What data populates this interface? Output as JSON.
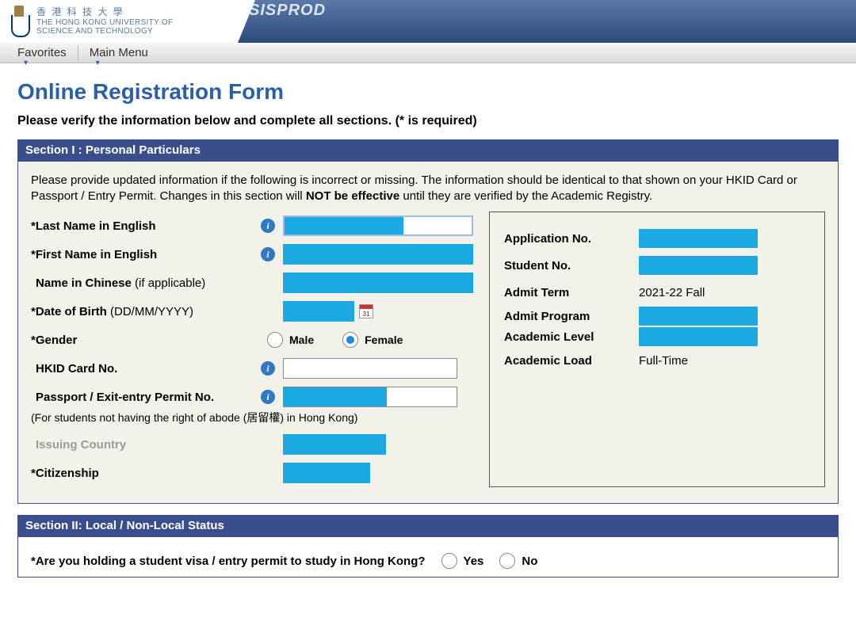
{
  "header": {
    "uni_zh": "香 港 科 技 大 學",
    "uni_en1": "THE HONG KONG UNIVERSITY OF",
    "uni_en2": "SCIENCE AND TECHNOLOGY",
    "sisprod": "SISPROD"
  },
  "menu": {
    "favorites": "Favorites",
    "main_menu": "Main Menu"
  },
  "page": {
    "title": "Online Registration Form",
    "instruction": "Please verify the information below and complete all sections. (* is required)"
  },
  "section1": {
    "header": "Section I : Personal Particulars",
    "desc_a": "Please provide updated information if the following is incorrect or missing. The information should be identical to that shown on your HKID Card or Passport / Entry Permit. Changes in this section will ",
    "desc_b": "NOT be effective",
    "desc_c": " until they are verified by the Academic Registry.",
    "labels": {
      "last_name": "*Last Name in English",
      "first_name": "*First Name in English",
      "name_chinese_a": "Name in Chinese ",
      "name_chinese_b": "(if applicable)",
      "dob_a": "*Date of Birth ",
      "dob_b": "(DD/MM/YYYY)",
      "gender": "*Gender",
      "male": "Male",
      "female": "Female",
      "hkid": "HKID Card No.",
      "passport": "Passport / Exit-entry Permit No.",
      "passport_note": "(For students not having the right of abode (居留權) in Hong Kong)",
      "issuing_country": "Issuing Country",
      "citizenship": "*Citizenship"
    },
    "right": {
      "app_no": "Application No.",
      "student_no": "Student No.",
      "admit_term": "Admit Term",
      "admit_term_val": "2021-22 Fall",
      "admit_program": "Admit Program",
      "academic_level": "Academic Level",
      "academic_load": "Academic Load",
      "academic_load_val": "Full-Time"
    }
  },
  "section2": {
    "header": "Section II: Local / Non-Local Status",
    "question": "*Are you holding a student visa / entry permit to study in Hong Kong?",
    "yes": "Yes",
    "no": "No"
  }
}
